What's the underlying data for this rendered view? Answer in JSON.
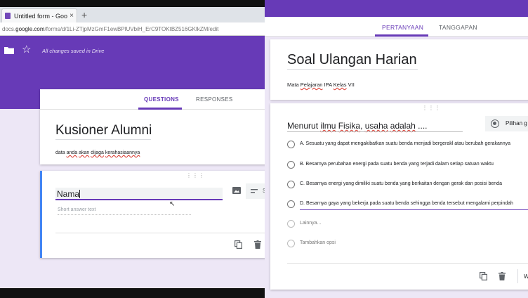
{
  "left": {
    "browser": {
      "tab_title": "Untitled form - Google",
      "tab_close": "×",
      "new_tab": "+",
      "url_prefix": "docs.",
      "url_host": "google.com",
      "url_path": "/forms/d/1Li-ZTjpMzGmF1ewBPlUVbiH_ErC9TOKtBZ516GKlkZM/edit"
    },
    "appbar": {
      "saved_status": "All changes saved in Drive"
    },
    "tabs": {
      "questions": "QUESTIONS",
      "responses": "RESPONSES"
    },
    "form": {
      "title": "Kusioner Alumni",
      "desc_1": "data ",
      "desc_2": "anda",
      "desc_3": " ",
      "desc_4": "akan",
      "desc_5": " ",
      "desc_6": "dijaga",
      "desc_7": " ",
      "desc_8": "kerahasiaannya"
    },
    "question": {
      "drag": "⋮⋮⋮",
      "title": "Nama",
      "type_label": "S",
      "placeholder": "Short answer text"
    }
  },
  "right": {
    "tabs": {
      "questions": "PERTANYAAN",
      "responses": "TANGGAPAN"
    },
    "form": {
      "title": "Soal Ulangan Harian",
      "desc_1": "Mata ",
      "desc_2": "Pelajaran",
      "desc_3": " IPA ",
      "desc_4": "Kelas",
      "desc_5": " VII"
    },
    "question": {
      "drag": "⋮⋮⋮",
      "title_1": "Menurut ",
      "title_2": "ilmu",
      "title_3": " ",
      "title_4": "Fisika",
      "title_5": ", ",
      "title_6": "usaha",
      "title_7": " ",
      "title_8": "adalah",
      "title_9": " ....",
      "type_label": "Pilihan g",
      "options": [
        "A. Sesuatu yang dapat mengakibatkan suatu benda menjadi bergerakl atau berubah gerakannya",
        "B. Besarnya perubahan energi pada suatu benda yang terjadi dalam setiap satuan waktu",
        "C. Besarnya energi yang dimiliki suatu benda yang berkaitan dengan gerak dan posisi benda",
        "D. Besarnya gaya yang bekerja pada suatu benda sehingga benda tersebut mengalami perpindah"
      ],
      "other_option": "Lainnya...",
      "add_option": "Tambahkan opsi",
      "required_label": "W"
    }
  },
  "colors": {
    "primary": "#673ab7",
    "background": "#ede7f6",
    "active_border": "#4285f4"
  }
}
